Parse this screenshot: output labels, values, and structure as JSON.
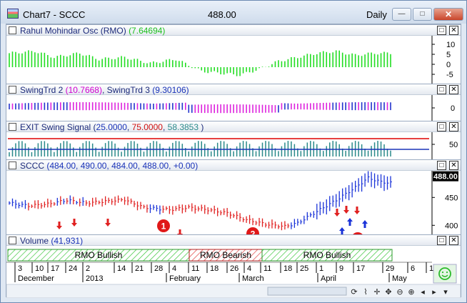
{
  "window": {
    "title": "Chart7 - SCCC",
    "price": "488.00",
    "period": "Daily",
    "min_label": "—",
    "max_label": "□",
    "close_label": "✕"
  },
  "panes": {
    "rmo": {
      "name": "Rahul Mohindar Osc (RMO)",
      "value": "(7.64694)",
      "ticks": [
        "10",
        "5",
        "0",
        "-5"
      ]
    },
    "swing": {
      "name1": "SwingTrd 2",
      "value1": "(10.7668)",
      "name2": "SwingTrd 3",
      "value2": "(9.30106)",
      "ticks": [
        "0"
      ]
    },
    "exit": {
      "name": "EXIT Swing Signal",
      "v1": "25.0000",
      "v2": "75.0000",
      "v3": "58.3853",
      "ticks": [
        "50"
      ]
    },
    "price": {
      "name": "SCCC",
      "ohlc": "(484.00, 490.00, 484.00, 488.00, +0.00)",
      "last": "488.00",
      "ticks": [
        "450",
        "400"
      ],
      "markers": [
        "1",
        "2",
        "3"
      ]
    },
    "volume": {
      "name": "Volume",
      "value": "(41,931)"
    }
  },
  "bands": [
    {
      "label": "RMO Bullish",
      "kind": "bull"
    },
    {
      "label": "RMO Bearish",
      "kind": "bear"
    },
    {
      "label": "RMO Bullish",
      "kind": "bull"
    }
  ],
  "date_axis": {
    "days": [
      "3",
      "10",
      "17",
      "24",
      "2",
      "14",
      "21",
      "28",
      "4",
      "11",
      "18",
      "26",
      "4",
      "11",
      "18",
      "25",
      "1",
      "9",
      "17",
      "29",
      "6",
      "13"
    ],
    "months": [
      "December",
      "2013",
      "February",
      "March",
      "April",
      "May"
    ]
  },
  "colors": {
    "rmo": "#22dd22",
    "swing_up": "#2233cc",
    "swing_dn": "#dd22dd",
    "signal_red": "#dd0000",
    "signal_blue": "#1a33b8",
    "bars": "#2a8a8a",
    "price_up": "#1a33d8",
    "price_dn": "#e02020",
    "arrow_up": "#1a33d8",
    "arrow_dn": "#e02020",
    "bull": "#3cc63c",
    "bear": "#e04040"
  },
  "toolbar_icons": [
    "sync-icon",
    "draw-icon",
    "crosshair-icon",
    "pan-icon",
    "zoom-out-icon",
    "zoom-in-icon",
    "scroll-left-icon",
    "scroll-right-icon",
    "menu-arrow-icon"
  ],
  "status_icon": "smiley-icon"
}
